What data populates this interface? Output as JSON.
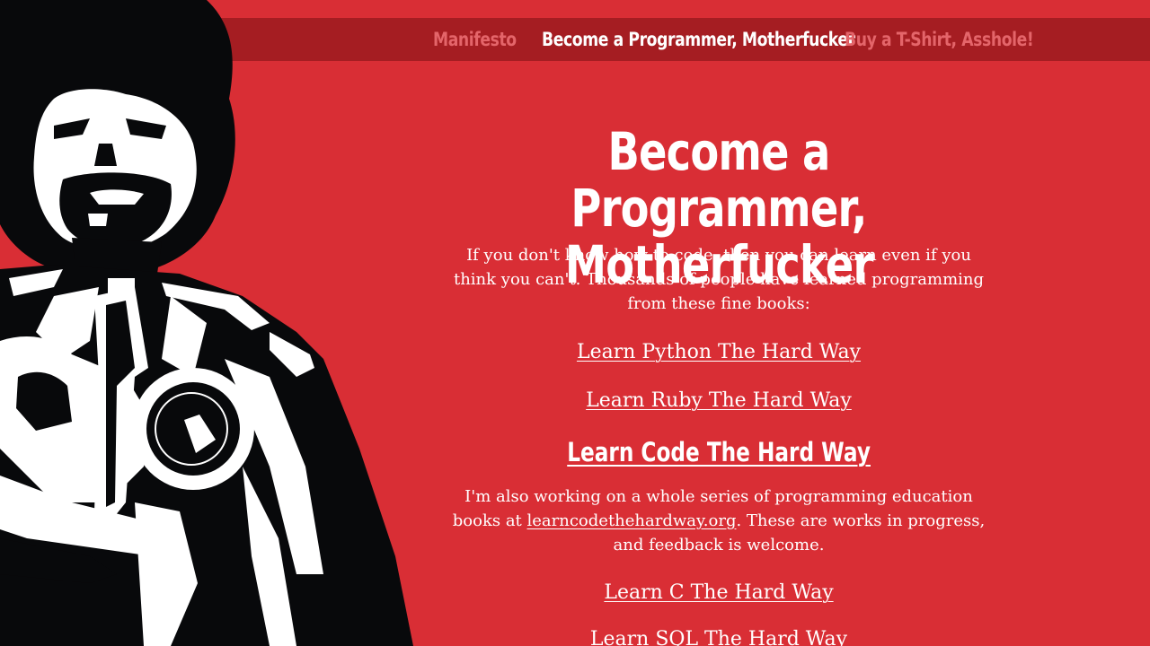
{
  "nav": {
    "items": [
      {
        "label": "Manifesto",
        "active": false
      },
      {
        "label": "Become a Programmer, Motherfucker",
        "active": true
      },
      {
        "label": "Buy a T-Shirt, Asshole!",
        "active": false
      }
    ]
  },
  "main": {
    "title_line1": "Become a Programmer,",
    "title_line2": "Motherfucker",
    "intro": "If you don't know how to code, then you can learn even if you think you can't. Thousands of people have learned programming from these fine books:",
    "books": {
      "python": "Learn Python The Hard Way",
      "ruby": "Learn Ruby The Hard Way",
      "code": "Learn Code The Hard Way"
    },
    "series_before": "I'm also working on a whole series of programming education books at ",
    "series_link": "learncodethehardway.org",
    "series_after": ". These are works in progress, and feedback is welcome.",
    "wip_books": {
      "c": "Learn C The Hard Way",
      "sql": "Learn SQL The Hard Way"
    }
  },
  "colors": {
    "background": "#d92e35",
    "navbar": "#a51d22",
    "nav_inactive": "#e4656a",
    "text": "#ffffff",
    "art_dark": "#08090b"
  }
}
